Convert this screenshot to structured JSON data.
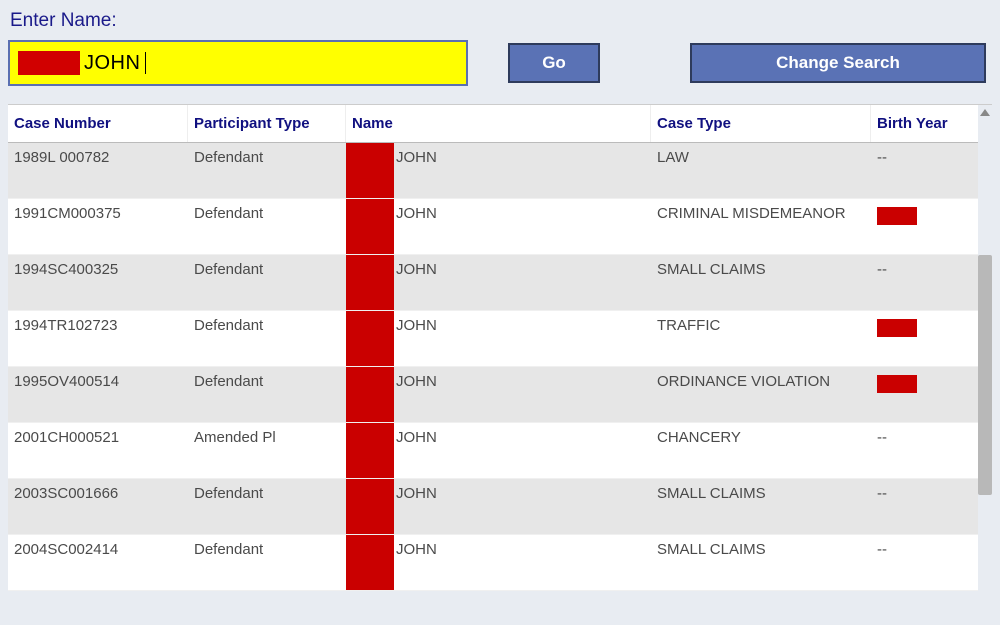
{
  "searchLabel": "Enter Name:",
  "searchValue": "JOHN",
  "buttons": {
    "go": "Go",
    "change": "Change Search"
  },
  "columns": {
    "caseNumber": "Case Number",
    "participantType": "Participant Type",
    "name": "Name",
    "caseType": "Case Type",
    "birthYear": "Birth Year"
  },
  "rows": [
    {
      "case": "1989L 000782",
      "ptype": "Defendant",
      "name": "JOHN",
      "ctype": "LAW",
      "byear": "--"
    },
    {
      "case": "1991CM000375",
      "ptype": "Defendant",
      "name": "JOHN",
      "ctype": "CRIMINAL MISDEMEANOR",
      "byear": "REDACTED"
    },
    {
      "case": "1994SC400325",
      "ptype": "Defendant",
      "name": "JOHN",
      "ctype": "SMALL CLAIMS",
      "byear": "--"
    },
    {
      "case": "1994TR102723",
      "ptype": "Defendant",
      "name": "JOHN",
      "ctype": "TRAFFIC",
      "byear": "REDACTED"
    },
    {
      "case": "1995OV400514",
      "ptype": "Defendant",
      "name": "JOHN",
      "ctype": "ORDINANCE VIOLATION",
      "byear": "REDACTED"
    },
    {
      "case": "2001CH000521",
      "ptype": "Amended Pl",
      "name": "JOHN",
      "ctype": "CHANCERY",
      "byear": "--"
    },
    {
      "case": "2003SC001666",
      "ptype": "Defendant",
      "name": "JOHN",
      "ctype": "SMALL CLAIMS",
      "byear": "--"
    },
    {
      "case": "2004SC002414",
      "ptype": "Defendant",
      "name": "JOHN",
      "ctype": "SMALL CLAIMS",
      "byear": "--"
    }
  ]
}
